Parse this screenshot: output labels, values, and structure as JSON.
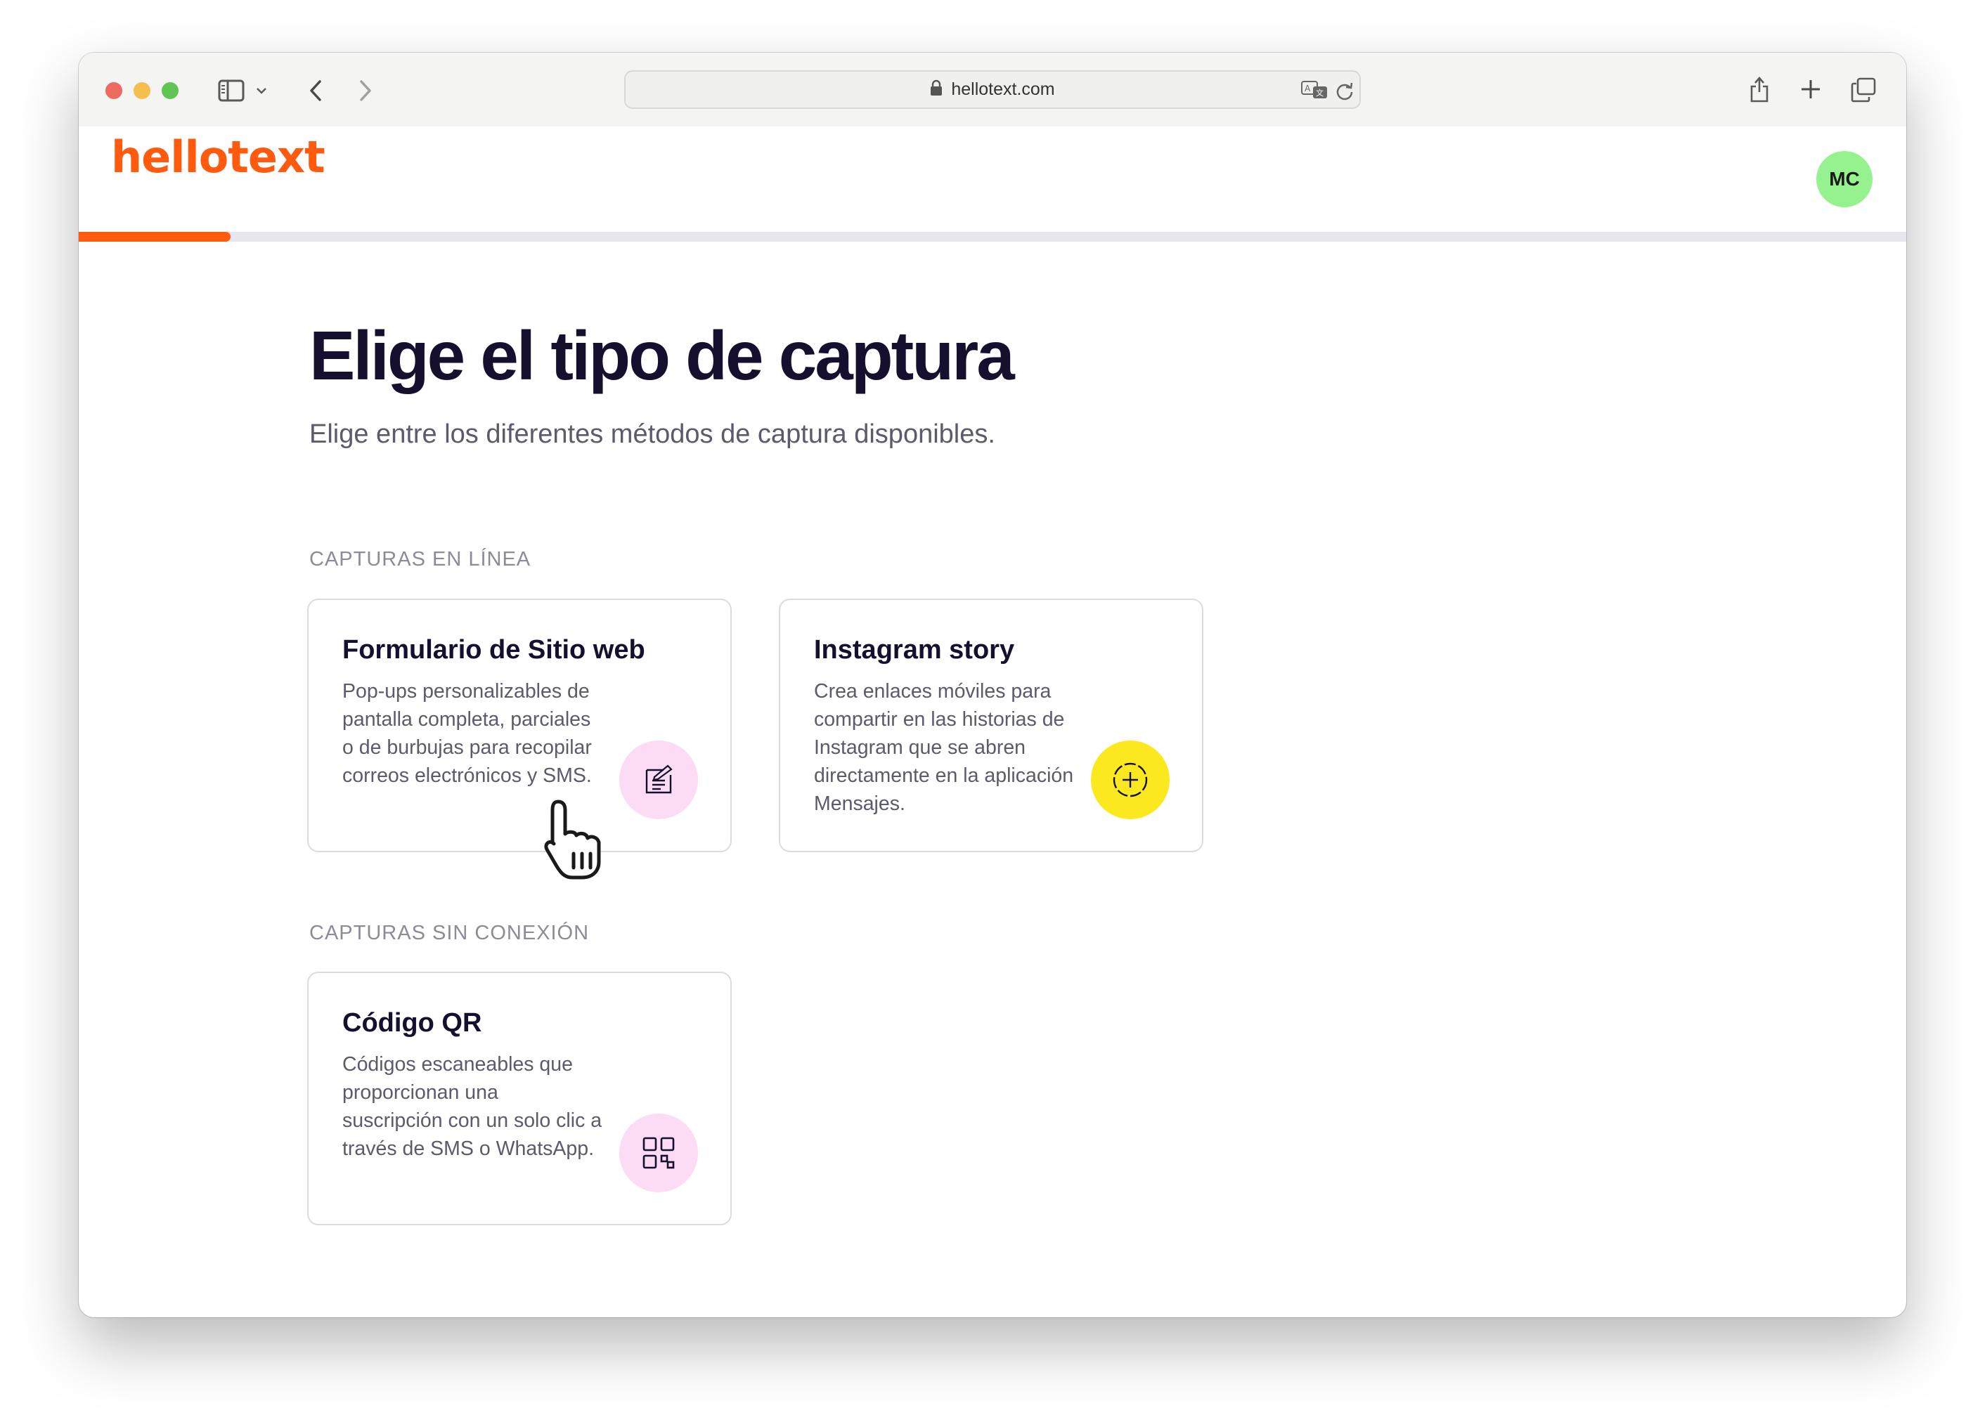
{
  "browser": {
    "url": "hellotext.com",
    "icons": [
      "sidebar-icon",
      "chevron-down-icon",
      "back-icon",
      "forward-icon",
      "lock-icon",
      "translate-icon",
      "reload-icon",
      "share-icon",
      "plus-icon",
      "tabs-icon"
    ]
  },
  "app": {
    "logo": "hellotext",
    "avatar_initials": "MC",
    "progress": 0.083,
    "brand_color": "#ff5a0e"
  },
  "main": {
    "title": "Elige el tipo de captura",
    "subtitle": "Elige entre los diferentes métodos de captura disponibles.",
    "sections": [
      {
        "label": "CAPTURAS EN LÍNEA",
        "cards": [
          {
            "title": "Formulario de Sitio web",
            "description": "Pop-ups personalizables de pantalla completa, parciales o de burbujas para recopilar correos electrónicos y SMS.",
            "icon": "form-icon",
            "icon_bg": "#fbdcf4"
          },
          {
            "title": "Instagram story",
            "description": "Crea enlaces móviles para compartir en las historias de Instagram que se abren directamente en la aplicación Mensajes.",
            "icon": "story-add-icon",
            "icon_bg": "#fbe81f"
          }
        ]
      },
      {
        "label": "CAPTURAS SIN CONEXIÓN",
        "cards": [
          {
            "title": "Código QR",
            "description": "Códigos escaneables que proporcionan una suscripción con un solo clic a través de SMS o WhatsApp.",
            "icon": "qr-code-icon",
            "icon_bg": "#fbdcf4"
          }
        ]
      }
    ]
  }
}
